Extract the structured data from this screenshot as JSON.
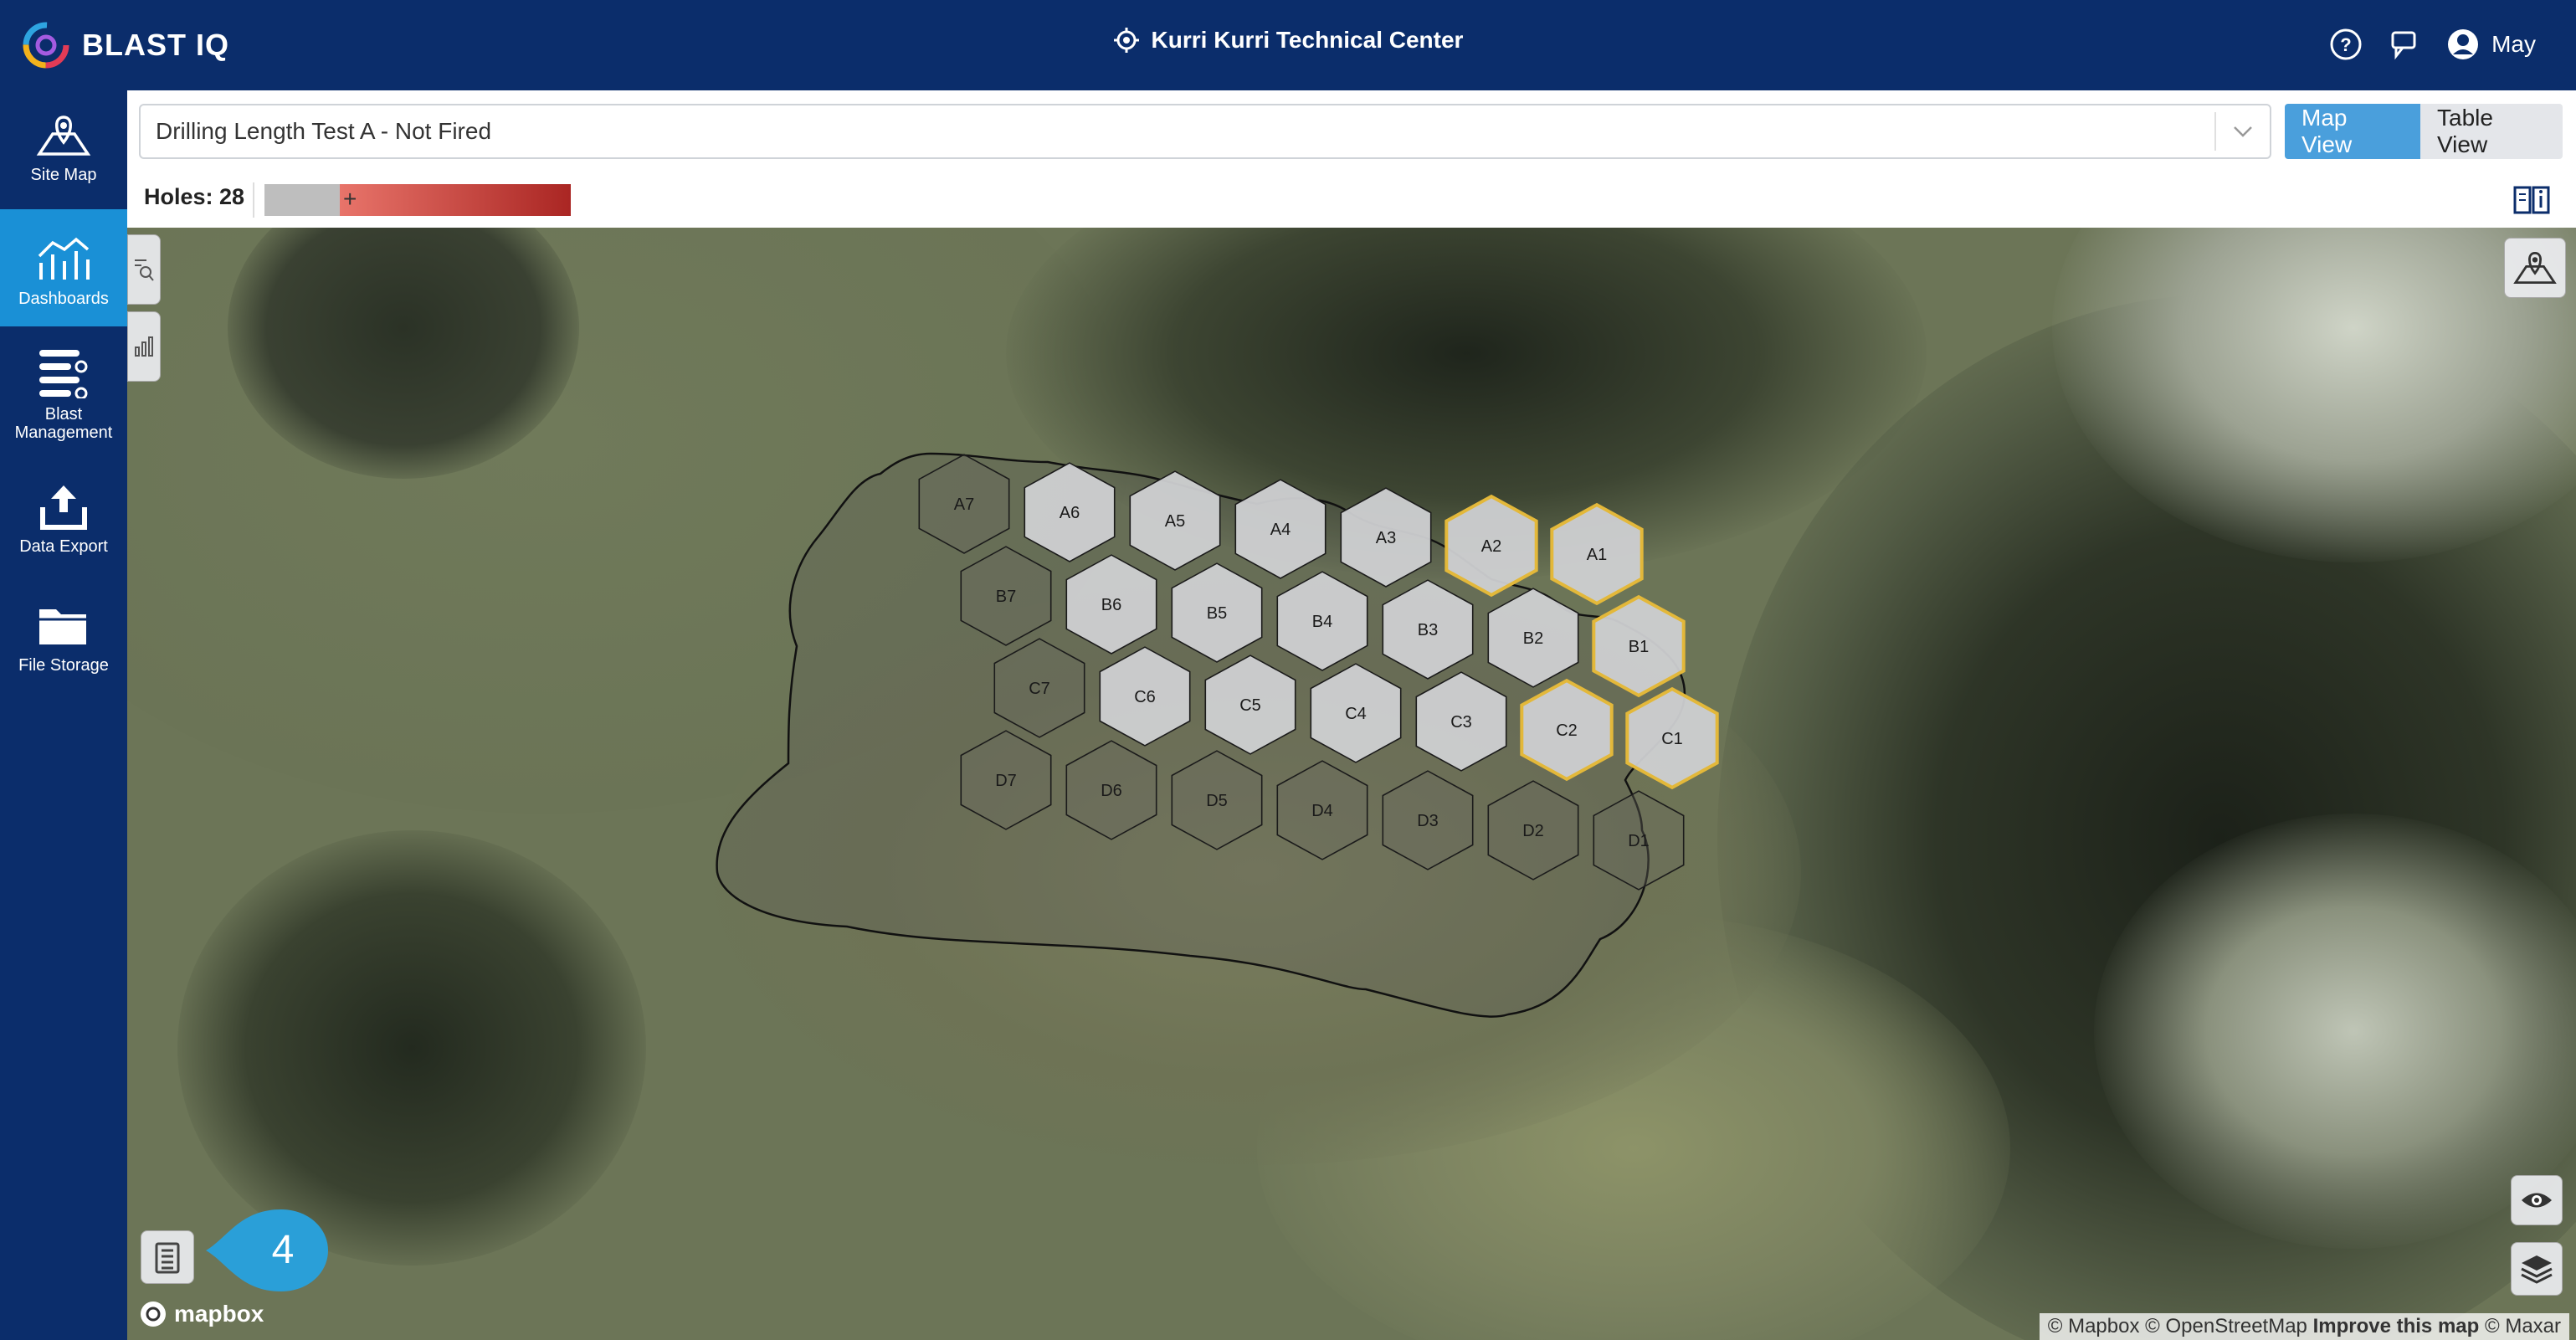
{
  "app": {
    "name": "BLAST IQ",
    "site": "Kurri Kurri Technical Center",
    "user": "May"
  },
  "sidebar": {
    "items": [
      {
        "label_lines": [
          "Site Map"
        ],
        "icon": "map-pin-icon",
        "active": false
      },
      {
        "label_lines": [
          "Dashboards"
        ],
        "icon": "dashboard-icon",
        "active": true
      },
      {
        "label_lines": [
          "Blast",
          "Management"
        ],
        "icon": "list-icon",
        "active": false
      },
      {
        "label_lines": [
          "Data Export"
        ],
        "icon": "upload-icon",
        "active": false
      },
      {
        "label_lines": [
          "File Storage"
        ],
        "icon": "folder-icon",
        "active": false
      }
    ]
  },
  "blast": {
    "selected": "Drilling Length Test A - Not Fired"
  },
  "view_toggle": {
    "map": "Map View",
    "table": "Table View",
    "active": "map"
  },
  "holes": {
    "label": "Holes: 28"
  },
  "colors": {
    "nav": "#0b2d6b",
    "accent": "#1a90d6",
    "highlight": "#e3b83a",
    "legend_red": "#aa2623"
  },
  "map": {
    "highlighted": [
      "A2",
      "A1",
      "B1",
      "C2",
      "C1"
    ],
    "cells": [
      {
        "id": "A7",
        "tone": "dark"
      },
      {
        "id": "A6",
        "tone": "light"
      },
      {
        "id": "A5",
        "tone": "light"
      },
      {
        "id": "A4",
        "tone": "light"
      },
      {
        "id": "A3",
        "tone": "light"
      },
      {
        "id": "A2",
        "tone": "light"
      },
      {
        "id": "A1",
        "tone": "light"
      },
      {
        "id": "B7",
        "tone": "dark"
      },
      {
        "id": "B6",
        "tone": "light"
      },
      {
        "id": "B5",
        "tone": "light"
      },
      {
        "id": "B4",
        "tone": "light"
      },
      {
        "id": "B3",
        "tone": "light"
      },
      {
        "id": "B2",
        "tone": "light"
      },
      {
        "id": "B1",
        "tone": "light"
      },
      {
        "id": "C7",
        "tone": "dark"
      },
      {
        "id": "C6",
        "tone": "light"
      },
      {
        "id": "C5",
        "tone": "light"
      },
      {
        "id": "C4",
        "tone": "light"
      },
      {
        "id": "C3",
        "tone": "light"
      },
      {
        "id": "C2",
        "tone": "light"
      },
      {
        "id": "C1",
        "tone": "light"
      },
      {
        "id": "D7",
        "tone": "dark"
      },
      {
        "id": "D6",
        "tone": "dark"
      },
      {
        "id": "D5",
        "tone": "dark"
      },
      {
        "id": "D4",
        "tone": "dark"
      },
      {
        "id": "D3",
        "tone": "dark"
      },
      {
        "id": "D2",
        "tone": "dark"
      },
      {
        "id": "D1",
        "tone": "dark"
      }
    ],
    "badge_count": "4",
    "mapbox_logo": "mapbox",
    "attribution": {
      "parts": [
        "© Mapbox",
        "© OpenStreetMap"
      ],
      "improve": "Improve this map",
      "maxar": "© Maxar"
    }
  }
}
